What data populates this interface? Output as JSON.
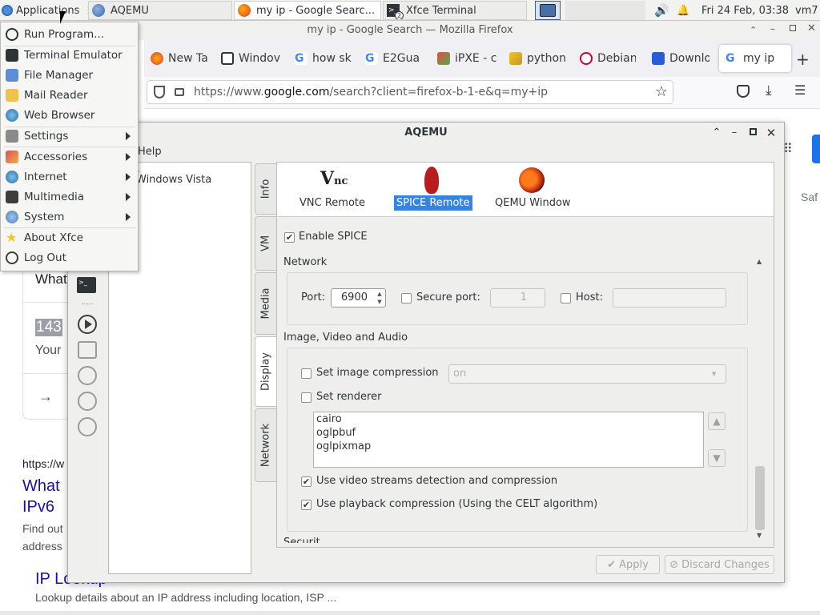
{
  "panel": {
    "applications_label": "Applications",
    "tasks": [
      {
        "label": "AQEMU"
      },
      {
        "label": "my ip - Google Searc..."
      },
      {
        "label": "Xfce Terminal"
      }
    ],
    "terminal_badge": "2",
    "clock": "Fri 24 Feb, 03:38",
    "user": "vm7"
  },
  "firefox": {
    "title": "my ip - Google Search — Mozilla Firefox",
    "tabs": [
      "New Ta",
      "Windov",
      "how sk",
      "E2Gua",
      "iPXE - c",
      "python",
      "Debian",
      "Downlo",
      "my ip"
    ],
    "url_prefix": "https://www.",
    "url_domain": "google.com",
    "url_rest": "/search?client=firefox-b-1-e&q=my+ip",
    "new_tab_symbol": "+",
    "google_fragments": {
      "what": "What",
      "ip_blur": "143",
      "your": "Your",
      "arrow": "→",
      "https_prefix": "https://w",
      "result_title_1": "What",
      "result_title_2": "IPv6",
      "snippet_1": "Find out",
      "snippet_2": "address",
      "ip_lookup_title": "IP Lookup",
      "ip_lookup_snippet": "Lookup details about an IP address including location, ISP ...",
      "safari_fragment": "Saf"
    }
  },
  "app_menu": {
    "items": [
      {
        "label": "Run Program...",
        "icon": "run-program-icon",
        "submenu": false
      },
      {
        "label": "Terminal Emulator",
        "icon": "terminal-icon",
        "submenu": false
      },
      {
        "label": "File Manager",
        "icon": "folder-icon",
        "submenu": false
      },
      {
        "label": "Mail Reader",
        "icon": "mail-icon",
        "submenu": false
      },
      {
        "label": "Web Browser",
        "icon": "globe-icon",
        "submenu": false
      },
      {
        "label": "Settings",
        "icon": "settings-icon",
        "submenu": true
      },
      {
        "label": "Accessories",
        "icon": "accessories-icon",
        "submenu": true
      },
      {
        "label": "Internet",
        "icon": "internet-icon",
        "submenu": true
      },
      {
        "label": "Multimedia",
        "icon": "multimedia-icon",
        "submenu": true
      },
      {
        "label": "System",
        "icon": "system-icon",
        "submenu": true
      },
      {
        "label": "About Xfce",
        "icon": "star-icon",
        "submenu": false
      },
      {
        "label": "Log Out",
        "icon": "logout-icon",
        "submenu": false
      }
    ]
  },
  "aqemu": {
    "title": "AQEMU",
    "menu_help": "Help",
    "vm_list": [
      {
        "name": "Windows Vista"
      }
    ],
    "side_tabs": [
      "Info",
      "VM",
      "Media",
      "Display",
      "Network"
    ],
    "modes": [
      "VNC Remote",
      "SPICE Remote",
      "QEMU Window"
    ],
    "selected_mode": "SPICE Remote",
    "enable_spice_label": "Enable SPICE",
    "enable_spice_checked": true,
    "network_section": "Network",
    "port_label": "Port:",
    "port_value": "6900",
    "secure_port_label": "Secure port:",
    "secure_port_value": "1",
    "host_label": "Host:",
    "host_value": "",
    "media_section": "Image, Video and Audio",
    "set_image_compression_label": "Set image compression",
    "image_compression_value": "on",
    "set_renderer_label": "Set renderer",
    "renderers": [
      "cairo",
      "oglpbuf",
      "oglpixmap"
    ],
    "video_streams_label": "Use video streams detection and compression",
    "playback_compression_label": "Use playback compression (Using the CELT algorithm)",
    "cut_section": "Securit",
    "apply_label": "Apply",
    "discard_label": "Discard Changes",
    "checkmark": "✔"
  }
}
